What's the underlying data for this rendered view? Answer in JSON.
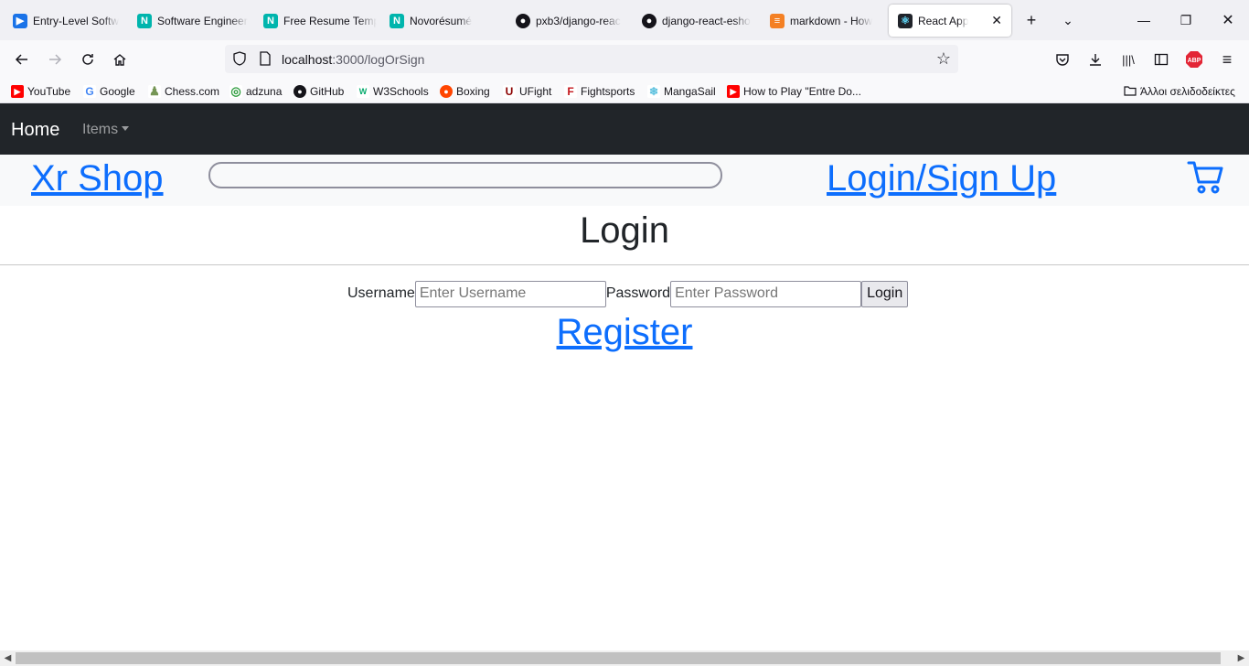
{
  "browser": {
    "tabs": [
      {
        "label": "Entry-Level Softw",
        "icon": "arrow-logo-icon",
        "color": "#1a73e8"
      },
      {
        "label": "Software Engineer",
        "icon": "novoresume-icon",
        "color": "#00b5ad"
      },
      {
        "label": "Free Resume Temp",
        "icon": "novoresume-icon",
        "color": "#00b5ad"
      },
      {
        "label": "Novorésumé",
        "icon": "novoresume-icon",
        "color": "#00b5ad"
      },
      {
        "label": "pxb3/django-reac",
        "icon": "github-icon",
        "color": "#15141a"
      },
      {
        "label": "django-react-esho",
        "icon": "github-icon",
        "color": "#15141a"
      },
      {
        "label": "markdown - How",
        "icon": "stackoverflow-icon",
        "color": "#f48024"
      },
      {
        "label": "React App",
        "icon": "react-icon",
        "color": "#61dafb"
      }
    ],
    "url": {
      "host": "localhost",
      "path": ":3000/logOrSign"
    },
    "bookmarks": [
      {
        "label": "YouTube",
        "icon": "youtube-icon",
        "color": "#ff0000"
      },
      {
        "label": "Google",
        "icon": "google-icon",
        "color": "#4285f4"
      },
      {
        "label": "Chess.com",
        "icon": "chess-icon",
        "color": "#769656"
      },
      {
        "label": "adzuna",
        "icon": "adzuna-icon",
        "color": "#2e9c3f"
      },
      {
        "label": "GitHub",
        "icon": "github-icon",
        "color": "#15141a"
      },
      {
        "label": "W3Schools",
        "icon": "w3schools-icon",
        "color": "#04aa6d"
      },
      {
        "label": "Boxing",
        "icon": "reddit-icon",
        "color": "#ff4500"
      },
      {
        "label": "UFight",
        "icon": "ufight-icon",
        "color": "#8b0000"
      },
      {
        "label": "Fightsports",
        "icon": "fightsports-icon",
        "color": "#c4161c"
      },
      {
        "label": "MangaSail",
        "icon": "mangasail-icon",
        "color": "#5bc0de"
      },
      {
        "label": "How to Play \"Entre Do...",
        "icon": "youtube-icon",
        "color": "#ff0000"
      }
    ],
    "other_bookmarks": "Άλλοι σελιδοδείκτες"
  },
  "site": {
    "nav": {
      "home": "Home",
      "items": "Items"
    },
    "header": {
      "shop_title": "Xr Shop",
      "login_link": "Login/Sign Up"
    },
    "heading": "Login",
    "form": {
      "username_label": "Username",
      "username_placeholder": "Enter Username",
      "password_label": "Password",
      "password_placeholder": "Enter Password",
      "login_button": "Login"
    },
    "register_link": "Register"
  },
  "colors": {
    "navbar_bg": "#212529",
    "link": "#0d6efd",
    "header_bg": "#f8f9fa"
  }
}
